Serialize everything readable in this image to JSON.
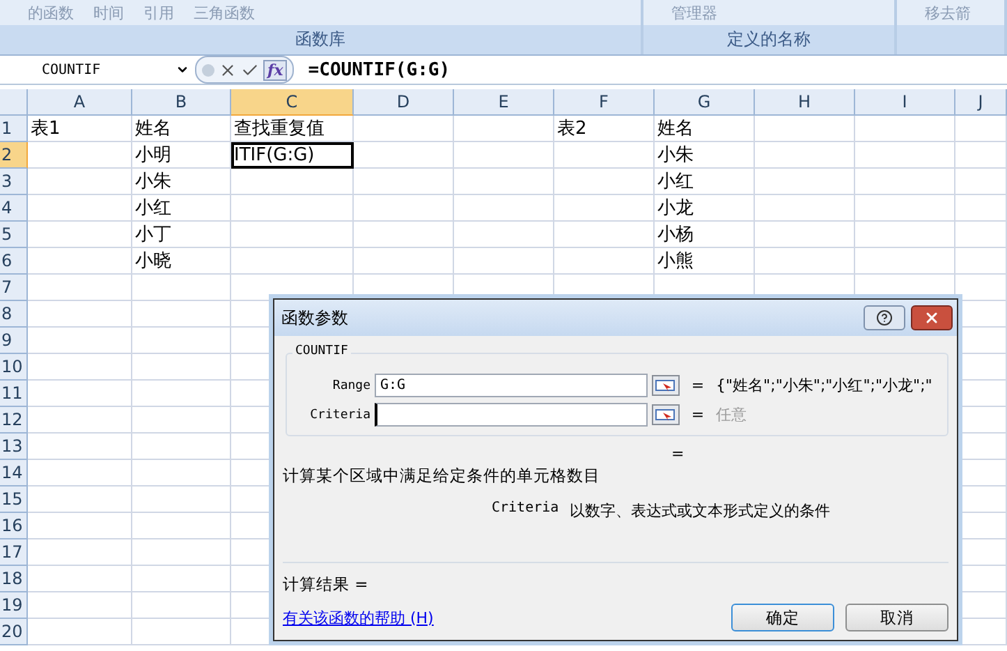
{
  "ribbon": {
    "groups": [
      {
        "commands": [
          "的函数",
          "时间",
          "引用",
          "三角函数"
        ],
        "label": "函数库"
      },
      {
        "commands": [
          "管理器"
        ],
        "label": "定义的名称"
      },
      {
        "commands": [
          "移去箭"
        ]
      }
    ]
  },
  "formula_bar": {
    "name_box": "COUNTIF",
    "insert_function": "fx",
    "formula": "=COUNTIF(G:G)"
  },
  "columns": [
    {
      "label": "A",
      "selected": false
    },
    {
      "label": "B",
      "selected": false
    },
    {
      "label": "C",
      "selected": true
    },
    {
      "label": "D",
      "selected": false
    },
    {
      "label": "E",
      "selected": false
    },
    {
      "label": "F",
      "selected": false
    },
    {
      "label": "G",
      "selected": false
    },
    {
      "label": "H",
      "selected": false
    },
    {
      "label": "I",
      "selected": false
    },
    {
      "label": "J",
      "selected": false
    }
  ],
  "rows": [
    {
      "number": "1",
      "selected": false,
      "cells": [
        {
          "text": "表1",
          "active": false
        },
        {
          "text": "姓名",
          "active": false
        },
        {
          "text": "查找重复值",
          "active": false
        },
        null,
        null,
        {
          "text": "表2",
          "active": false
        },
        {
          "text": "姓名",
          "active": false
        },
        null,
        null,
        null
      ]
    },
    {
      "number": "2",
      "selected": true,
      "cells": [
        null,
        {
          "text": "小明",
          "active": false
        },
        {
          "text": "ITIF(G:G)",
          "active": true
        },
        null,
        null,
        null,
        {
          "text": "小朱",
          "active": false
        },
        null,
        null,
        null
      ]
    },
    {
      "number": "3",
      "selected": false,
      "cells": [
        null,
        {
          "text": "小朱",
          "active": false
        },
        null,
        null,
        null,
        null,
        {
          "text": "小红",
          "active": false
        },
        null,
        null,
        null
      ]
    },
    {
      "number": "4",
      "selected": false,
      "cells": [
        null,
        {
          "text": "小红",
          "active": false
        },
        null,
        null,
        null,
        null,
        {
          "text": "小龙",
          "active": false
        },
        null,
        null,
        null
      ]
    },
    {
      "number": "5",
      "selected": false,
      "cells": [
        null,
        {
          "text": "小丁",
          "active": false
        },
        null,
        null,
        null,
        null,
        {
          "text": "小杨",
          "active": false
        },
        null,
        null,
        null
      ]
    },
    {
      "number": "6",
      "selected": false,
      "cells": [
        null,
        {
          "text": "小晓",
          "active": false
        },
        null,
        null,
        null,
        null,
        {
          "text": "小熊",
          "active": false
        },
        null,
        null,
        null
      ]
    },
    {
      "number": "7",
      "selected": false
    },
    {
      "number": "8",
      "selected": false
    },
    {
      "number": "9",
      "selected": false
    },
    {
      "number": "10",
      "selected": false
    },
    {
      "number": "11",
      "selected": false
    },
    {
      "number": "12",
      "selected": false
    },
    {
      "number": "13",
      "selected": false
    },
    {
      "number": "14",
      "selected": false
    },
    {
      "number": "15",
      "selected": false
    },
    {
      "number": "16",
      "selected": false
    },
    {
      "number": "17",
      "selected": false
    },
    {
      "number": "18",
      "selected": false
    },
    {
      "number": "19",
      "selected": false
    },
    {
      "number": "20",
      "selected": false
    }
  ],
  "dialog": {
    "title": "函数参数",
    "function_name": "COUNTIF",
    "arguments": [
      {
        "label": "Range",
        "value": "G:G",
        "focused": false,
        "equals": "=",
        "result": "{\"姓名\";\"小朱\";\"小红\";\"小龙\";\"",
        "muted": false
      },
      {
        "label": "Criteria",
        "focused": true,
        "equals": "=",
        "result": "任意",
        "muted": true
      }
    ],
    "formula_result": "=",
    "description": "计算某个区域中满足给定条件的单元格数目",
    "argument_help": {
      "label": "Criteria",
      "text": "以数字、表达式或文本形式定义的条件"
    },
    "result_label": "计算结果 =",
    "help_link": "有关该函数的帮助 (H)",
    "buttons": [
      {
        "label": "确定",
        "default": true
      },
      {
        "label": "取消",
        "default": false
      }
    ]
  }
}
